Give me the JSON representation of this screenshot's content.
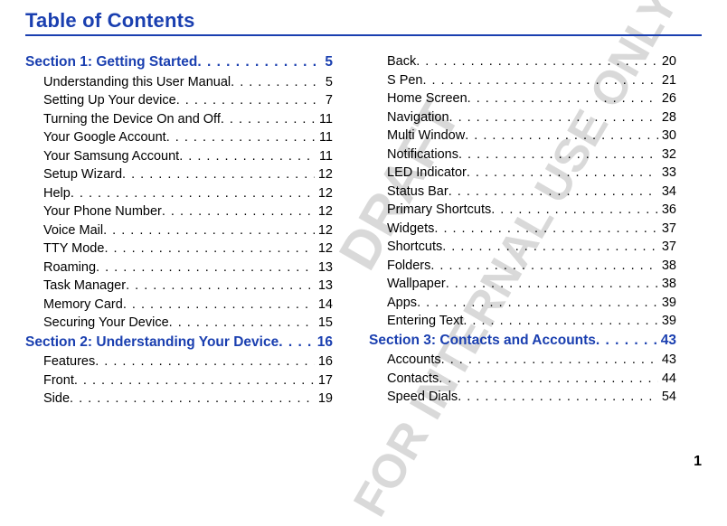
{
  "title": "Table of Contents",
  "watermark1": "DRAFT",
  "watermark2": "FOR INTERNAL USE ONLY",
  "page_number": "1",
  "left": {
    "sections": [
      {
        "type": "section",
        "label": "Section 1:  Getting Started",
        "page": "5"
      },
      {
        "type": "entry",
        "label": "Understanding this User Manual",
        "page": "5"
      },
      {
        "type": "entry",
        "label": "Setting Up Your device",
        "page": "7"
      },
      {
        "type": "entry",
        "label": "Turning the Device On and Off",
        "page": "11"
      },
      {
        "type": "entry",
        "label": "Your Google Account",
        "page": "11"
      },
      {
        "type": "entry",
        "label": "Your Samsung Account",
        "page": "11"
      },
      {
        "type": "entry",
        "label": "Setup Wizard",
        "page": "12"
      },
      {
        "type": "entry",
        "label": "Help",
        "page": "12"
      },
      {
        "type": "entry",
        "label": "Your Phone Number",
        "page": "12"
      },
      {
        "type": "entry",
        "label": "Voice Mail",
        "page": "12"
      },
      {
        "type": "entry",
        "label": "TTY Mode",
        "page": "12"
      },
      {
        "type": "entry",
        "label": "Roaming",
        "page": "13"
      },
      {
        "type": "entry",
        "label": "Task Manager",
        "page": "13"
      },
      {
        "type": "entry",
        "label": "Memory Card",
        "page": "14"
      },
      {
        "type": "entry",
        "label": "Securing Your Device",
        "page": "15"
      },
      {
        "type": "section",
        "label": "Section 2:  Understanding Your Device",
        "page": "16"
      },
      {
        "type": "entry",
        "label": "Features",
        "page": "16"
      },
      {
        "type": "entry",
        "label": "Front",
        "page": "17"
      },
      {
        "type": "entry",
        "label": "Side",
        "page": "19"
      }
    ]
  },
  "right": {
    "sections": [
      {
        "type": "entry",
        "label": "Back",
        "page": "20"
      },
      {
        "type": "entry",
        "label": "S Pen",
        "page": "21"
      },
      {
        "type": "entry",
        "label": "Home Screen",
        "page": "26"
      },
      {
        "type": "entry",
        "label": "Navigation",
        "page": "28"
      },
      {
        "type": "entry",
        "label": "Multi Window",
        "page": "30"
      },
      {
        "type": "entry",
        "label": "Notifications",
        "page": "32"
      },
      {
        "type": "entry",
        "label": "LED Indicator",
        "page": "33"
      },
      {
        "type": "entry",
        "label": "Status Bar",
        "page": "34"
      },
      {
        "type": "entry",
        "label": "Primary Shortcuts",
        "page": "36"
      },
      {
        "type": "entry",
        "label": "Widgets",
        "page": "37"
      },
      {
        "type": "entry",
        "label": "Shortcuts",
        "page": "37"
      },
      {
        "type": "entry",
        "label": "Folders",
        "page": "38"
      },
      {
        "type": "entry",
        "label": "Wallpaper",
        "page": "38"
      },
      {
        "type": "entry",
        "label": "Apps",
        "page": "39"
      },
      {
        "type": "entry",
        "label": "Entering Text",
        "page": "39"
      },
      {
        "type": "section",
        "label": "Section 3:  Contacts and Accounts",
        "page": "43"
      },
      {
        "type": "entry",
        "label": "Accounts",
        "page": "43"
      },
      {
        "type": "entry",
        "label": "Contacts",
        "page": "44"
      },
      {
        "type": "entry",
        "label": "Speed Dials",
        "page": "54"
      }
    ]
  }
}
